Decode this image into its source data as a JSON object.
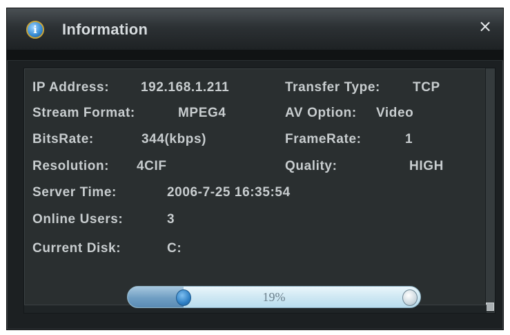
{
  "window": {
    "title": "Information",
    "title_icon": "info-icon",
    "title_icon_glyph": "i",
    "close_glyph": "×"
  },
  "info": {
    "ip_label": "IP Address:",
    "ip_value": "192.168.1.211",
    "transfer_label": "Transfer Type:",
    "transfer_value": "TCP",
    "stream_label": "Stream Format:",
    "stream_value": "MPEG4",
    "av_label": "AV Option:",
    "av_value": "Video",
    "bitrate_label": "BitsRate:",
    "bitrate_value": "344(kbps)",
    "framerate_label": "FrameRate:",
    "framerate_value": "1",
    "resolution_label": "Resolution:",
    "resolution_value": "4CIF",
    "quality_label": "Quality:",
    "quality_value": "HIGH",
    "server_time_label": "Server Time:",
    "server_time_value": "2006-7-25 16:35:54",
    "online_users_label": "Online Users:",
    "online_users_value": "3",
    "current_disk_label": "Current Disk:",
    "current_disk_value": "C:"
  },
  "progress": {
    "text": "19%",
    "fraction": 0.19
  },
  "colors": {
    "window_bg": "#1c2022",
    "content_bg": "#2a2f30",
    "text": "#c8cdcf",
    "progress_fill": "#6f9ec3"
  }
}
